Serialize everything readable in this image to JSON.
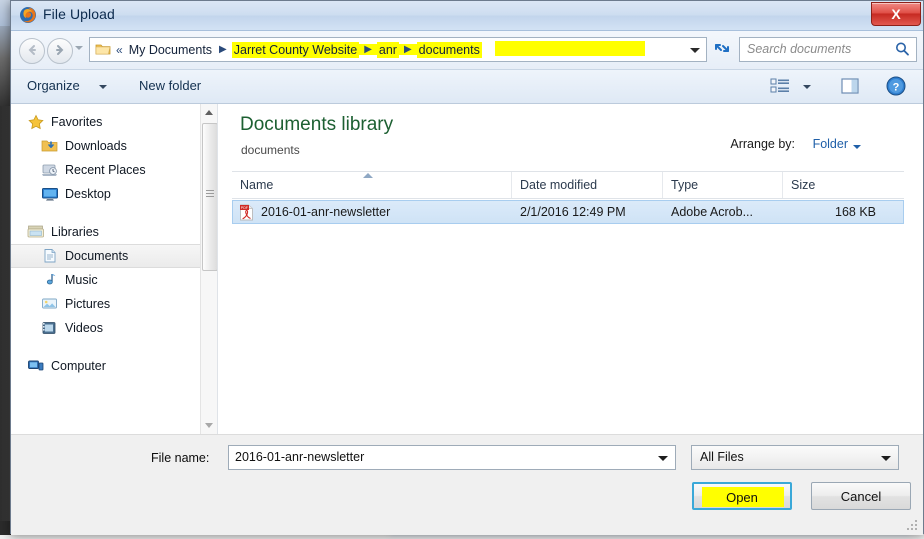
{
  "window": {
    "title": "File Upload",
    "app_icon": "firefox-icon",
    "close_label": "X"
  },
  "address_bar": {
    "folder_icon": "folder-icon",
    "double_chevron": "«",
    "separator": "▶",
    "crumbs": [
      {
        "label": "My Documents",
        "highlighted": false
      },
      {
        "label": "Jarret County Website",
        "highlighted": true
      },
      {
        "label": "anr",
        "highlighted": true
      },
      {
        "label": "documents",
        "highlighted": true
      }
    ],
    "refresh_icon": "refresh-icon",
    "dropdown_icon": "chevron-down-icon"
  },
  "search": {
    "placeholder": "Search documents",
    "icon": "search-icon"
  },
  "toolbar": {
    "organize_label": "Organize",
    "new_folder_label": "New folder",
    "view_icon": "view-mode-icon",
    "preview_icon": "preview-pane-icon",
    "help_icon": "help-icon"
  },
  "nav_pane": {
    "groups": [
      {
        "header": {
          "label": "Favorites",
          "icon": "star-icon"
        },
        "items": [
          {
            "label": "Downloads",
            "icon": "downloads-folder-icon",
            "selected": false
          },
          {
            "label": "Recent Places",
            "icon": "recent-places-icon",
            "selected": false
          },
          {
            "label": "Desktop",
            "icon": "desktop-icon",
            "selected": false
          }
        ]
      },
      {
        "header": {
          "label": "Libraries",
          "icon": "libraries-icon"
        },
        "items": [
          {
            "label": "Documents",
            "icon": "documents-library-icon",
            "selected": true
          },
          {
            "label": "Music",
            "icon": "music-library-icon",
            "selected": false
          },
          {
            "label": "Pictures",
            "icon": "pictures-library-icon",
            "selected": false
          },
          {
            "label": "Videos",
            "icon": "videos-library-icon",
            "selected": false
          }
        ]
      },
      {
        "header": {
          "label": "Computer",
          "icon": "computer-icon"
        },
        "items": []
      }
    ]
  },
  "content": {
    "library_title": "Documents library",
    "library_subtitle": "documents",
    "arrange_by_label": "Arrange by:",
    "arrange_by_value": "Folder",
    "columns": [
      {
        "label": "Name",
        "sorted": "asc"
      },
      {
        "label": "Date modified",
        "sorted": ""
      },
      {
        "label": "Type",
        "sorted": ""
      },
      {
        "label": "Size",
        "sorted": ""
      }
    ],
    "rows": [
      {
        "icon": "pdf-file-icon",
        "name": "2016-01-anr-newsletter",
        "date_modified": "2/1/2016 12:49 PM",
        "type": "Adobe Acrob...",
        "size": "168 KB",
        "selected": true
      }
    ]
  },
  "footer": {
    "file_name_label": "File name:",
    "file_name_value": "2016-01-anr-newsletter",
    "file_type_value": "All Files",
    "open_label": "Open",
    "cancel_label": "Cancel"
  },
  "colors": {
    "highlight_yellow": "#ffff00",
    "library_green": "#1d6032",
    "link_blue": "#1f5fa8",
    "selection_blue": "#cfe3f6",
    "focus_ring": "#3aa8d8",
    "close_red": "#c62a22"
  }
}
